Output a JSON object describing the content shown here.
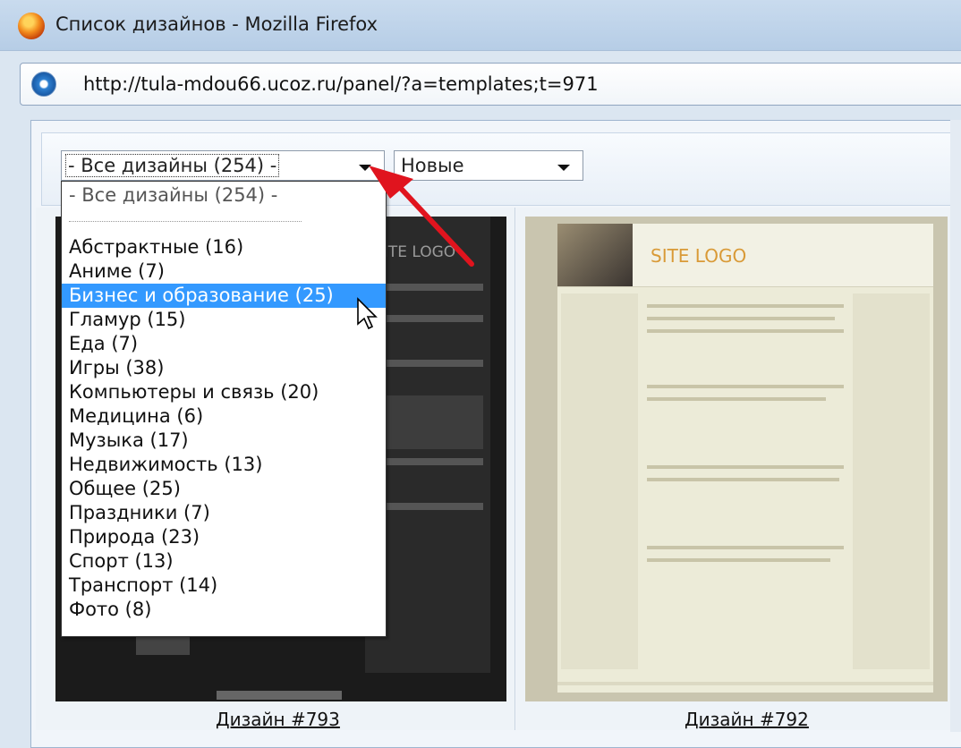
{
  "window": {
    "title": "Список дизайнов - Mozilla Firefox",
    "url": "http://tula-mdou66.ucoz.ru/panel/?a=templates;t=971"
  },
  "filters": {
    "category_selected": "- Все дизайны (254) -",
    "sort_selected": "Новые"
  },
  "dropdown": {
    "options": [
      "- Все дизайны (254) -",
      "Абстрактные (16)",
      "Аниме (7)",
      "Бизнес и образование (25)",
      "Гламур (15)",
      "Еда (7)",
      "Игры (38)",
      "Компьютеры и связь (20)",
      "Медицина (6)",
      "Музыка (17)",
      "Недвижимость (13)",
      "Общее (25)",
      "Праздники (7)",
      "Природа (23)",
      "Спорт (13)",
      "Транспорт (14)",
      "Фото (8)"
    ],
    "highlighted": "Бизнес и образование (25)"
  },
  "designs": [
    {
      "caption": "Дизайн #793",
      "thumb_logo": "SITE LOGO"
    },
    {
      "caption": "Дизайн #792",
      "thumb_logo": "SITE LOGO"
    }
  ],
  "colors": {
    "highlight": "#3399ff",
    "arrow": "#e0141e",
    "logo": "#d99a37"
  },
  "icons": [
    "firefox-icon",
    "site-icon",
    "dropdown-arrow-icon",
    "mouse-pointer-icon"
  ]
}
